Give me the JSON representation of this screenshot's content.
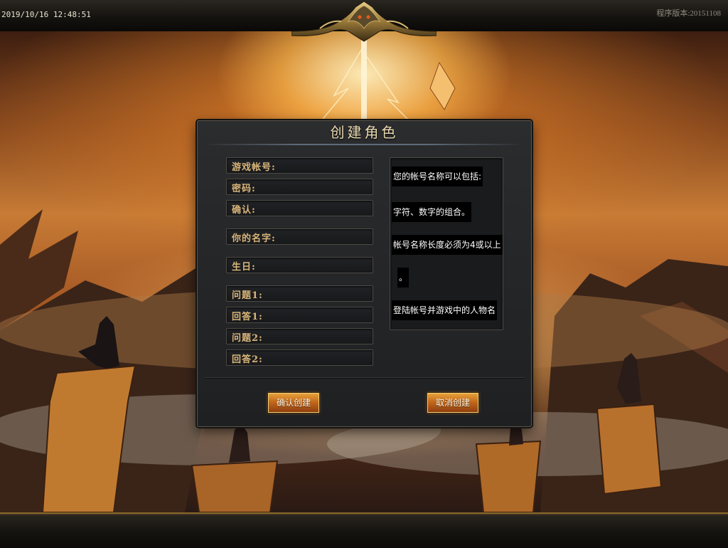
{
  "topbar": {
    "datetime": "2019/10/16 12:48:51",
    "version": "程序版本:20151108"
  },
  "dialog": {
    "title": "创建角色",
    "fields": [
      {
        "label": "游戏帐号:",
        "value": ""
      },
      {
        "label": "密码:",
        "value": ""
      },
      {
        "label": "确认:",
        "value": ""
      },
      {
        "label": "你的名字:",
        "value": ""
      },
      {
        "label": "生日:",
        "value": ""
      },
      {
        "label": "问题1:",
        "value": ""
      },
      {
        "label": "回答1:",
        "value": ""
      },
      {
        "label": "问题2:",
        "value": ""
      },
      {
        "label": "回答2:",
        "value": ""
      }
    ],
    "info_lines": [
      "您的帐号名称可以包括:",
      "字符、数字的组合。",
      "帐号名称长度必须为4或以上",
      "。",
      "登陆帐号并游戏中的人物名"
    ],
    "confirm_label": "确认创建",
    "cancel_label": "取消创建"
  },
  "colors": {
    "label_gold": "#d9b57a",
    "button_orange": "#c2681c",
    "panel_bg": "#1f2022"
  },
  "icons": [
    "dragon-crest-icon"
  ]
}
